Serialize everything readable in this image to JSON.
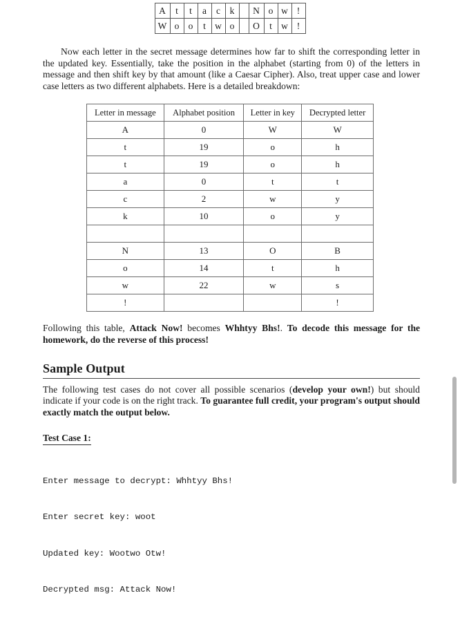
{
  "cipher_strip": {
    "message_row": [
      "A",
      "t",
      "t",
      "a",
      "c",
      "k",
      "",
      "N",
      "o",
      "w",
      "!"
    ],
    "key_row": [
      "W",
      "o",
      "o",
      "t",
      "w",
      "o",
      "",
      "O",
      "t",
      "w",
      "!"
    ]
  },
  "intro_paragraph": {
    "text": "Now each letter in the secret message determines how far to shift the corresponding letter in the updated key. Essentially, take the position in the alphabet (starting from 0) of the letters in message and then shift key by that amount (like a Caesar Cipher). Also, treat upper case and lower case letters as two different alphabets. Here is a detailed breakdown:"
  },
  "breakdown_table": {
    "headers": [
      "Letter in message",
      "Alphabet position",
      "Letter in key",
      "Decrypted letter"
    ],
    "rows": [
      [
        "A",
        "0",
        "W",
        "W"
      ],
      [
        "t",
        "19",
        "o",
        "h"
      ],
      [
        "t",
        "19",
        "o",
        "h"
      ],
      [
        "a",
        "0",
        "t",
        "t"
      ],
      [
        "c",
        "2",
        "w",
        "y"
      ],
      [
        "k",
        "10",
        "o",
        "y"
      ],
      [
        "",
        "",
        "",
        ""
      ],
      [
        "N",
        "13",
        "O",
        "B"
      ],
      [
        "o",
        "14",
        "t",
        "h"
      ],
      [
        "w",
        "22",
        "w",
        "s"
      ],
      [
        "!",
        "",
        "",
        "!"
      ]
    ]
  },
  "following_paragraph": {
    "lead": "Following this table, ",
    "plaintext_bold": "Attack Now!",
    "middle": " becomes ",
    "ciphertext_bold": "Whhtyy Bhs!",
    "period": ". ",
    "instruction_bold": "To decode this message for the homework, do the reverse of this process!"
  },
  "sample_output_section": {
    "heading": "Sample Output",
    "body": {
      "part1": "The following test cases do not cover all possible scenarios (",
      "bold1": "develop your own!",
      "part2": ") but should indicate if your code is on the right track. ",
      "bold2": "To guarantee full credit, your program's output should exactly match the output below."
    }
  },
  "test_case": {
    "title": "Test Case 1:",
    "lines": [
      "Enter message to decrypt: Whhtyy Bhs!",
      "Enter secret key: woot",
      "Updated key: Wootwo Otw!",
      "Decrypted msg: Attack Now!"
    ]
  },
  "colors": {
    "page_background": "#ffffff",
    "text": "#1a1a1a",
    "table_border": "#6b6b6b",
    "scrollbar_thumb": "#b5b5b5"
  }
}
